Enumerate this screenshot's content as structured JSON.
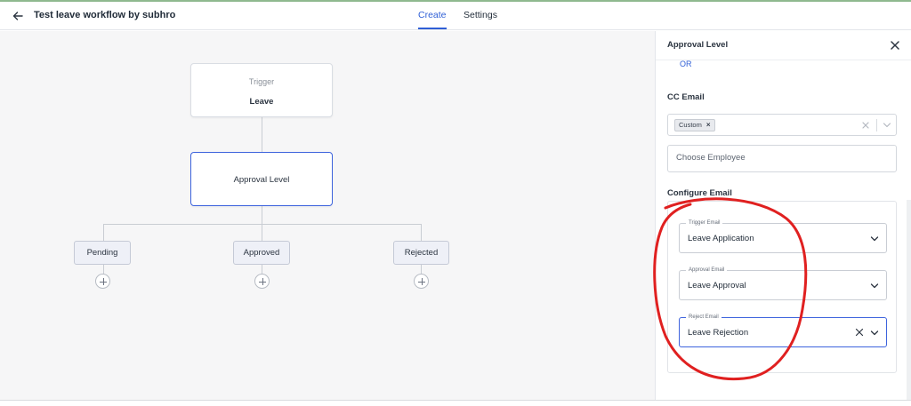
{
  "header": {
    "title": "Test leave workflow by subhro",
    "tabs": [
      {
        "label": "Create",
        "active": true
      },
      {
        "label": "Settings",
        "active": false
      }
    ]
  },
  "workflow": {
    "trigger": {
      "label": "Trigger",
      "value": "Leave"
    },
    "approval_node": {
      "label": "Approval Level"
    },
    "branches": [
      {
        "label": "Pending"
      },
      {
        "label": "Approved"
      },
      {
        "label": "Rejected"
      }
    ]
  },
  "panel": {
    "title": "Approval Level",
    "or_label": "OR",
    "cc_email": {
      "label": "CC Email",
      "tags": [
        "Custom"
      ],
      "employee_placeholder": "Choose Employee"
    },
    "configure_email": {
      "label": "Configure Email",
      "fields": [
        {
          "legend": "Trigger Email",
          "value": "Leave Application",
          "focused": false
        },
        {
          "legend": "Approval Email",
          "value": "Leave Approval",
          "focused": false
        },
        {
          "legend": "Reject Email",
          "value": "Leave Rejection",
          "focused": true
        }
      ]
    }
  },
  "colors": {
    "accent": "#2f5fd6",
    "selected_border": "#3d63dd",
    "annotation": "#e02020",
    "canvas_bg": "#f6f6f7"
  },
  "icons": [
    "arrow-left-icon",
    "close-icon",
    "chevron-down-icon",
    "clear-x-icon",
    "plus-icon"
  ]
}
